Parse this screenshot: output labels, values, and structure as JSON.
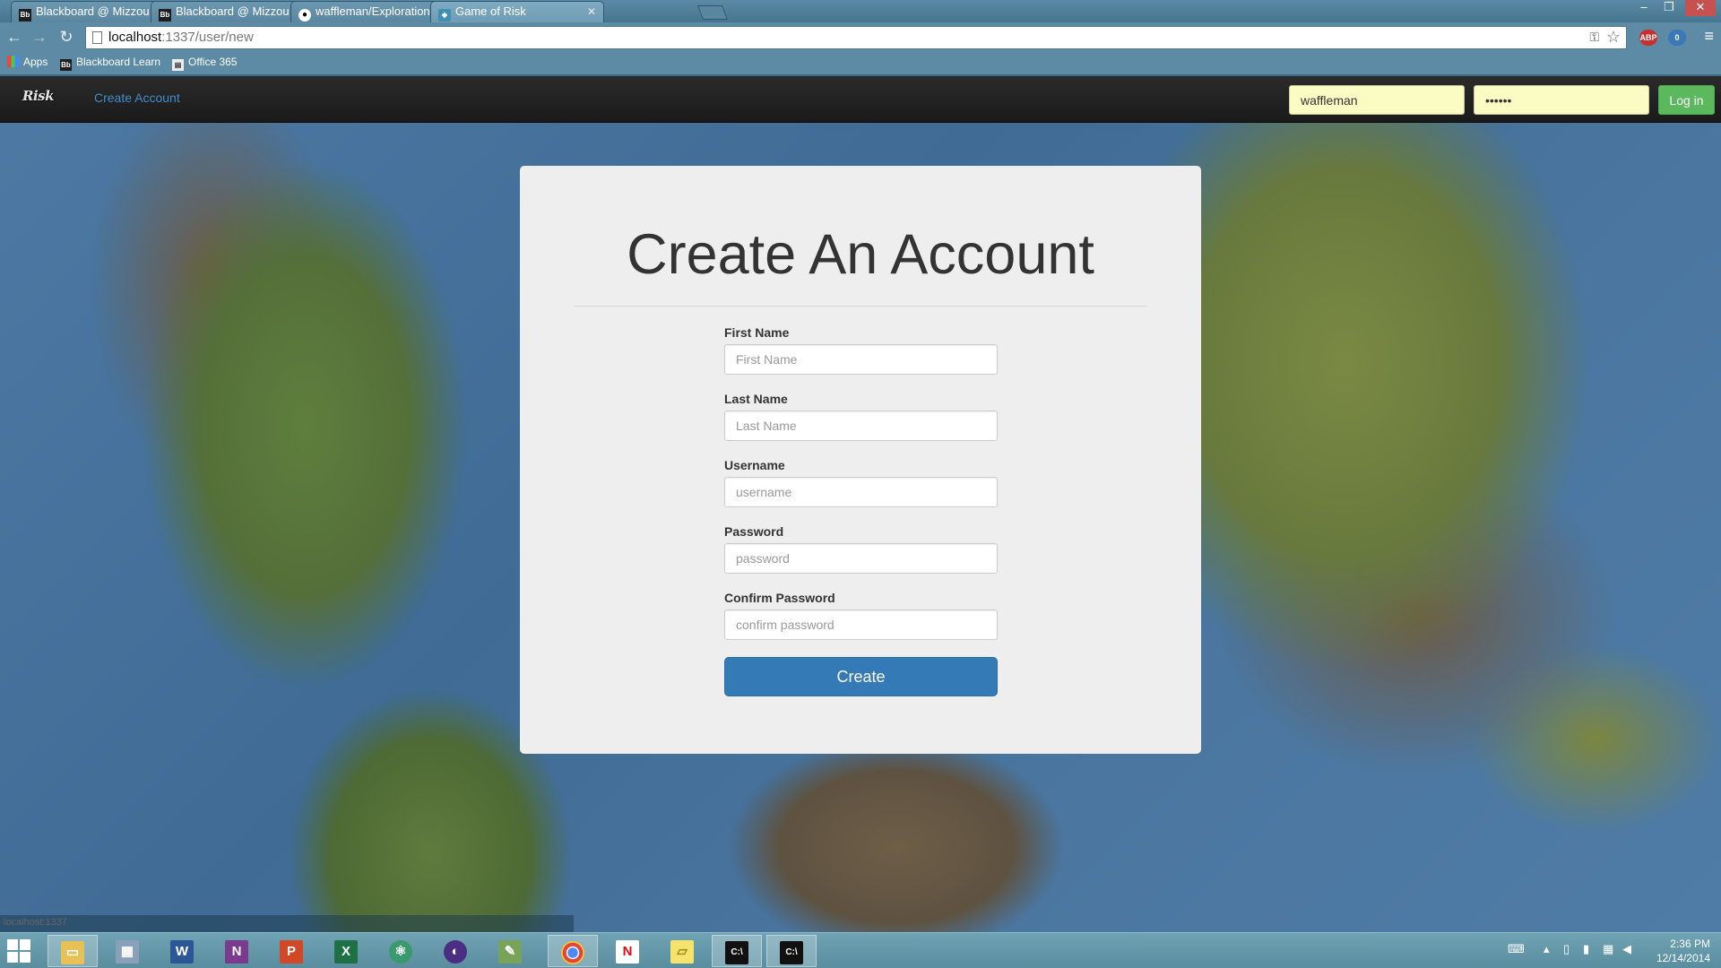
{
  "browser": {
    "tabs": [
      {
        "label": "Blackboard @ Mizzou",
        "icon": "Bb"
      },
      {
        "label": "Blackboard @ Mizzou",
        "icon": "Bb"
      },
      {
        "label": "waffleman/Exploration-A",
        "icon": "gh"
      },
      {
        "label": "Game of Risk",
        "icon": "risk"
      }
    ],
    "address": {
      "host": "localhost",
      "rest": ":1337/user/new"
    },
    "bookmarks": [
      {
        "label": "Apps"
      },
      {
        "label": "Blackboard Learn",
        "icon": "Bb"
      },
      {
        "label": "Office 365"
      }
    ],
    "extensions": {
      "adblock": "ABP",
      "badge": "0"
    }
  },
  "navbar": {
    "brand": "Risk",
    "create_account_link": "Create Account",
    "username_value": "waffleman",
    "password_value": "••••••",
    "login_label": "Log in"
  },
  "form": {
    "title": "Create An Account",
    "fields": [
      {
        "label": "First Name",
        "placeholder": "First Name"
      },
      {
        "label": "Last Name",
        "placeholder": "Last Name"
      },
      {
        "label": "Username",
        "placeholder": "username"
      },
      {
        "label": "Password",
        "placeholder": "password"
      },
      {
        "label": "Confirm Password",
        "placeholder": "confirm password"
      }
    ],
    "submit_label": "Create"
  },
  "status_bar": {
    "url": "localhost:1337"
  },
  "taskbar": {
    "clock": {
      "time": "2:36 PM",
      "date": "12/14/2014"
    },
    "apps": [
      "file-explorer",
      "calculator",
      "word",
      "onenote",
      "powerpoint",
      "excel",
      "atom",
      "eclipse",
      "notepad",
      "chrome",
      "netflix",
      "sticky-notes",
      "cmd",
      "cmd"
    ]
  },
  "colors": {
    "navbar_bg": "#222222",
    "link": "#428bca",
    "login_button": "#5cb85c",
    "primary_button": "#337ab7",
    "card_bg": "#eeeeee",
    "autofill_yellow": "#fbfbc4"
  }
}
